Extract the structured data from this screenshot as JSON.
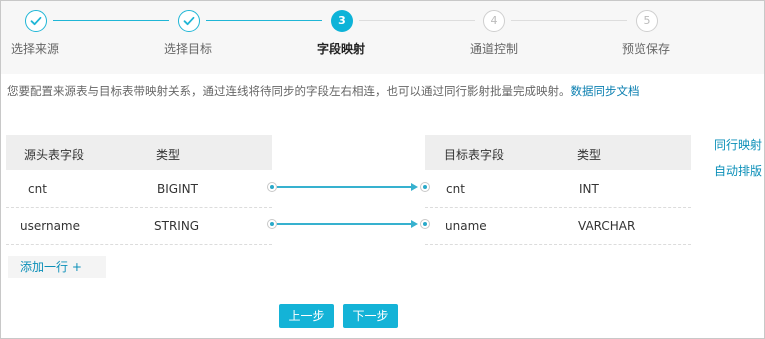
{
  "steps": [
    {
      "num": "1",
      "label": "选择来源",
      "state": "done"
    },
    {
      "num": "2",
      "label": "选择目标",
      "state": "done"
    },
    {
      "num": "3",
      "label": "字段映射",
      "state": "active"
    },
    {
      "num": "4",
      "label": "通道控制",
      "state": "todo"
    },
    {
      "num": "5",
      "label": "预览保存",
      "state": "todo"
    }
  ],
  "info": {
    "text": "您要配置来源表与目标表带映射关系，通过连线将待同步的字段左右相连，也可以通过同行影射批量完成映射。",
    "link": "数据同步文档"
  },
  "source_table": {
    "headers": [
      "源头表字段",
      "类型"
    ],
    "rows": [
      {
        "field": "cnt",
        "type": "BIGINT"
      },
      {
        "field": "username",
        "type": "STRING"
      }
    ],
    "add_row": "添加一行 +"
  },
  "target_table": {
    "headers": [
      "目标表字段",
      "类型"
    ],
    "rows": [
      {
        "field": "cnt",
        "type": "INT"
      },
      {
        "field": "uname",
        "type": "VARCHAR"
      }
    ]
  },
  "side_actions": {
    "same_row_map": "同行映射",
    "auto_layout": "自动排版"
  },
  "buttons": {
    "prev": "上一步",
    "next": "下一步"
  },
  "colors": {
    "accent": "#14b3d7",
    "link": "#0b8fb8"
  }
}
